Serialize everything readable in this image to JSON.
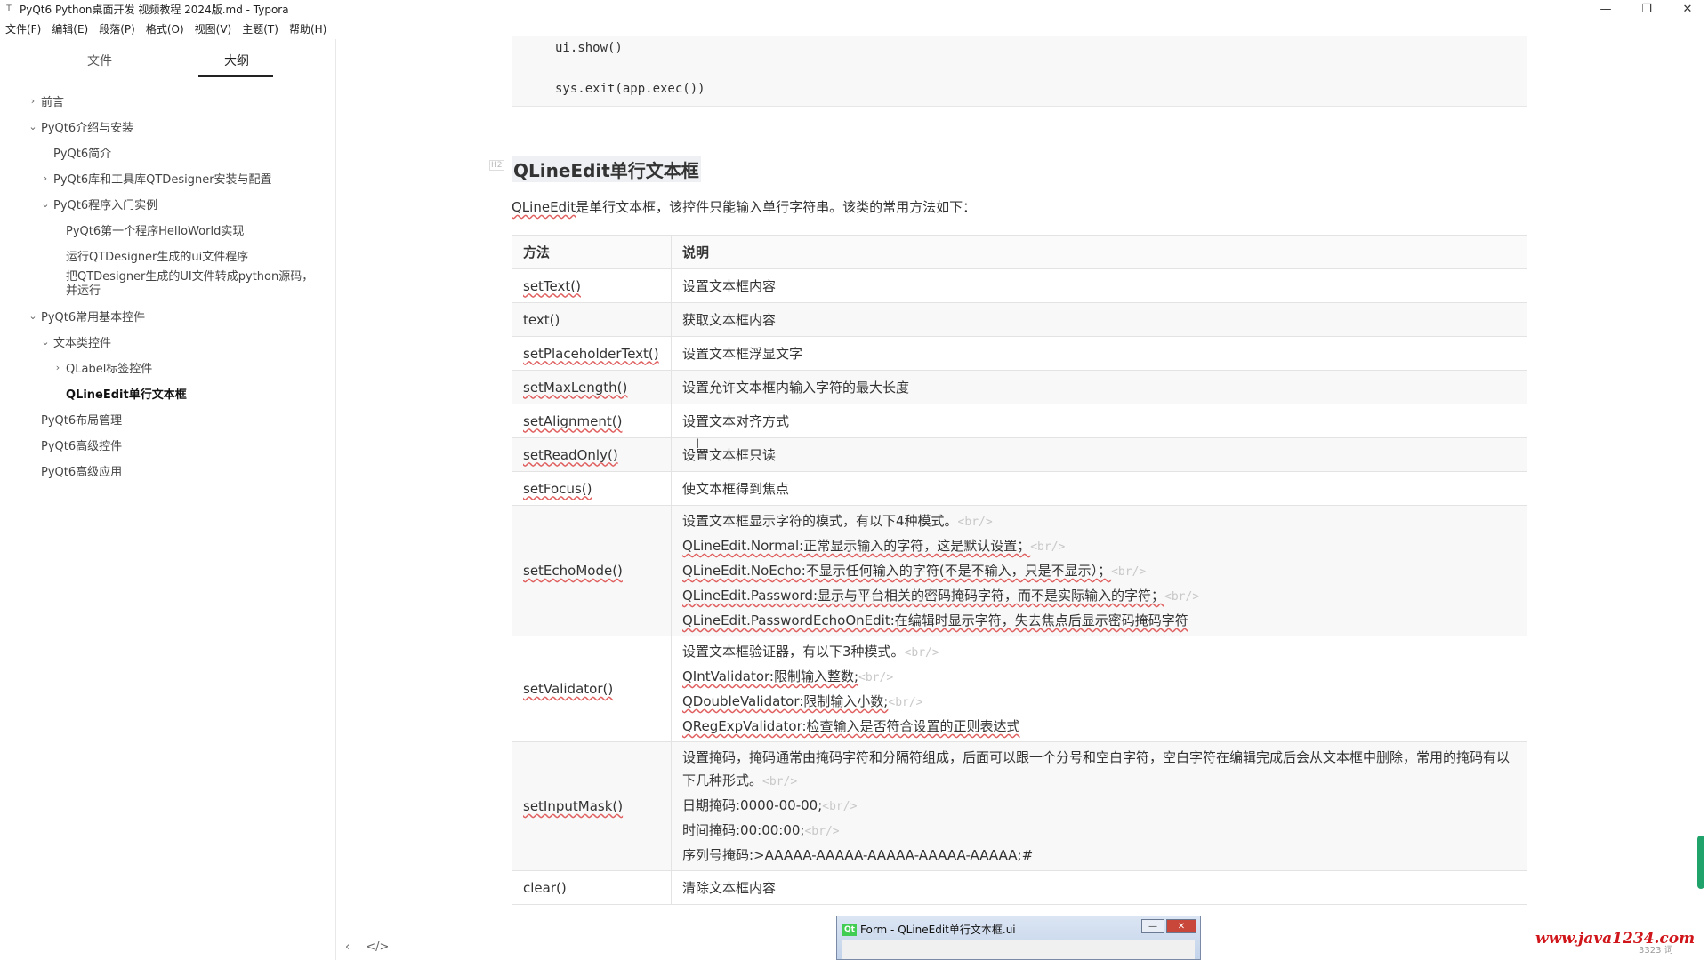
{
  "window": {
    "title": "PyQt6 Python桌面开发 视频教程 2024版.md - Typora",
    "app_icon": "T",
    "minimize": "—",
    "restore": "❐",
    "close": "✕"
  },
  "menu": [
    "文件(F)",
    "编辑(E)",
    "段落(P)",
    "格式(O)",
    "视图(V)",
    "主题(T)",
    "帮助(H)"
  ],
  "sidebar": {
    "tab_files": "文件",
    "tab_outline": "大纲",
    "items": [
      {
        "label": "前言",
        "chev": "›"
      },
      {
        "label": "PyQt6介绍与安装",
        "chev": "⌄"
      },
      {
        "label": "PyQt6简介",
        "chev": ""
      },
      {
        "label": "PyQt6库和工具库QTDesigner安装与配置",
        "chev": "›"
      },
      {
        "label": "PyQt6程序入门实例",
        "chev": "⌄"
      },
      {
        "label": "PyQt6第一个程序HelloWorld实现",
        "chev": ""
      },
      {
        "label": "运行QTDesigner生成的ui文件程序",
        "chev": ""
      },
      {
        "label": "把QTDesigner生成的UI文件转成python源码，并运行",
        "chev": ""
      },
      {
        "label": "PyQt6常用基本控件",
        "chev": "⌄"
      },
      {
        "label": "文本类控件",
        "chev": "⌄"
      },
      {
        "label": "QLabel标签控件",
        "chev": "›"
      },
      {
        "label": "QLineEdit单行文本框",
        "chev": ""
      },
      {
        "label": "PyQt6布局管理",
        "chev": ""
      },
      {
        "label": "PyQt6高级控件",
        "chev": ""
      },
      {
        "label": "PyQt6高级应用",
        "chev": ""
      }
    ],
    "footer_left": "‹",
    "footer_source": "</>"
  },
  "content": {
    "code_lines": [
      "ui.show()",
      "sys.exit(app.exec())"
    ],
    "heading": "QLineEdit单行文本框",
    "intro_link": "QLineEdit",
    "intro_rest": "是单行文本框，该控件只能输入单行字符串。该类的常用方法如下：",
    "table": {
      "headers": [
        "方法",
        "说明"
      ],
      "rows": [
        {
          "method": "setText()",
          "desc": [
            "设置文本框内容"
          ]
        },
        {
          "method": "text()",
          "desc": [
            "获取文本框内容"
          ]
        },
        {
          "method": "setPlaceholderText()",
          "desc": [
            "设置文本框浮显文字"
          ]
        },
        {
          "method": "setMaxLength()",
          "desc": [
            "设置允许文本框内输入字符的最大长度"
          ]
        },
        {
          "method": "setAlignment()",
          "desc": [
            "设置文本对齐方式"
          ]
        },
        {
          "method": "setReadOnly()",
          "desc": [
            "设置文本框只读"
          ]
        },
        {
          "method": "setFocus()",
          "desc": [
            "使文本框得到焦点"
          ]
        },
        {
          "method": "setEchoMode()",
          "desc": [
            "设置文本框显示字符的模式，有以下4种模式。",
            "QLineEdit.Normal:正常显示输入的字符，这是默认设置；",
            "QLineEdit.NoEcho:不显示任何输入的字符(不是不输入，只是不显示）；",
            "QLineEdit.Password:显示与平台相关的密码掩码字符，而不是实际输入的字符；",
            "QLineEdit.PasswordEchoOnEdit:在编辑时显示字符，失去焦点后显示密码掩码字符"
          ]
        },
        {
          "method": "setValidator()",
          "desc": [
            "设置文本框验证器，有以下3种模式。",
            " QIntValidator:限制输入整数;",
            "QDoubleValidator:限制输入小数;",
            "QRegExpValidator:检查输入是否符合设置的正则表达式"
          ]
        },
        {
          "method": "setInputMask()",
          "desc": [
            "设置掩码，掩码通常由掩码字符和分隔符组成，后面可以跟一个分号和空白字符，空白字符在编辑完成后会从文本框中删除，常用的掩码有以下几种形式。",
            "日期掩码:0000-00-00;",
            "时间掩码:00:00:00;",
            "序列号掩码:>AAAAA-AAAAA-AAAAA-AAAAA-AAAAA;#"
          ]
        },
        {
          "method": "clear()",
          "desc": [
            "清除文本框内容"
          ]
        }
      ],
      "br_tag": "<br/>"
    }
  },
  "preview": {
    "icon": "Qt",
    "title": "Form - QLineEdit单行文本框.ui",
    "min": "—",
    "close": "✕"
  },
  "watermark": "www.java1234.com",
  "wordcount": "3323 词",
  "cursor": "I"
}
